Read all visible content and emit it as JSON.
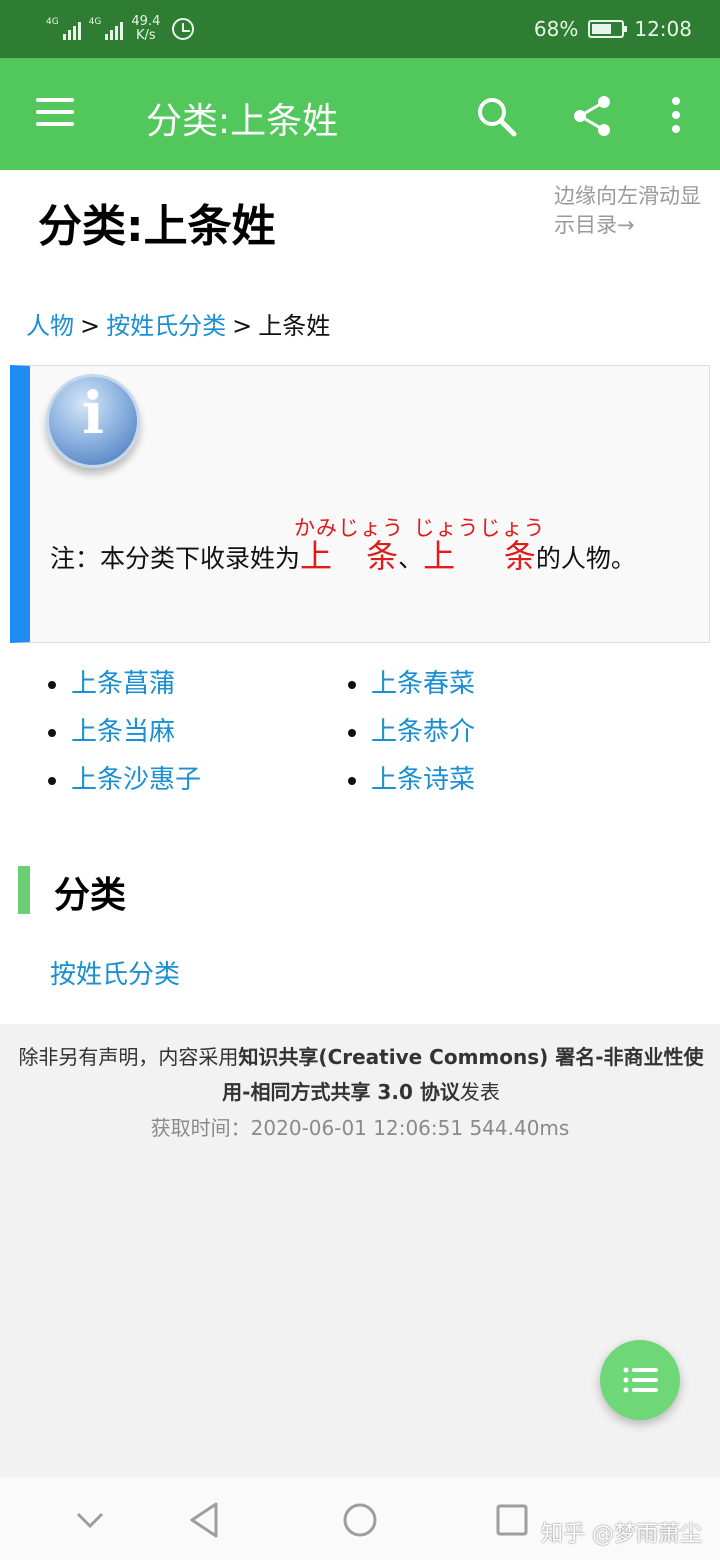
{
  "status_bar": {
    "network_1": "4G",
    "network_2": "4G",
    "speed_value": "49.4",
    "speed_unit": "K/s",
    "battery_percent": "68%",
    "battery_level": 0.68,
    "time": "12:08"
  },
  "toolbar": {
    "title": "分类:上条姓",
    "icons": [
      "menu-icon",
      "search-icon",
      "share-icon",
      "more-vert-icon"
    ]
  },
  "page": {
    "title": "分类:上条姓",
    "swipe_hint": "边缘向左滑动显示目录→"
  },
  "breadcrumb": {
    "items": [
      "人物",
      "按姓氏分类",
      "上条姓"
    ],
    "separator": ">"
  },
  "notice": {
    "prefix": "注：本分类下收录姓为",
    "surname1": "上 条",
    "reading1": "かみじょう",
    "comma": "、",
    "surname2": "上 条",
    "reading2": "じょうじょう",
    "suffix": "的人物。"
  },
  "names": [
    "上条菖蒲",
    "上条春菜",
    "上条当麻",
    "上条恭介",
    "上条沙惠子",
    "上条诗菜"
  ],
  "categories": {
    "heading": "分类",
    "links": [
      "按姓氏分类"
    ]
  },
  "footer": {
    "license_prefix": "除非另有声明，内容采用",
    "license_bold": "知识共享(Creative Commons) 署名-非商业性使用-相同方式共享 3.0 协议",
    "license_suffix": "发表",
    "fetch_time": "获取时间：2020-06-01 12:06:51 544.40ms"
  },
  "watermark": "知乎 @梦雨萧尘",
  "colors": {
    "status_bar": "#2f7d32",
    "toolbar": "#52c75b",
    "link": "#1a8fd1",
    "notice_accent": "#1e8cf0",
    "surname_red": "#e01b1b",
    "section_bar": "#6ccf73",
    "fab": "#6ed879"
  }
}
